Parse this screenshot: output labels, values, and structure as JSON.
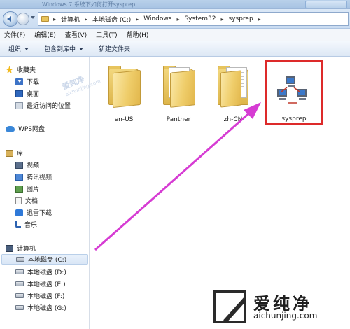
{
  "window": {
    "title_faded": "Windows 7 系统下如何打开sysprep"
  },
  "address": {
    "crumbs": [
      "计算机",
      "本地磁盘 (C:)",
      "Windows",
      "System32",
      "sysprep"
    ],
    "separator": "▸"
  },
  "menu": [
    "文件(F)",
    "编辑(E)",
    "查看(V)",
    "工具(T)",
    "帮助(H)"
  ],
  "toolbar": {
    "organize": "组织",
    "include_library": "包含到库中",
    "new_folder": "新建文件夹"
  },
  "sidebar": {
    "favorites": {
      "label": "收藏夹",
      "items": [
        "下载",
        "桌面",
        "最近访问的位置"
      ]
    },
    "wps": {
      "label": "WPS网盘"
    },
    "libraries": {
      "label": "库",
      "items": [
        "视频",
        "腾讯视频",
        "图片",
        "文档",
        "迅雷下载",
        "音乐"
      ]
    },
    "computer": {
      "label": "计算机",
      "drives": [
        "本地磁盘 (C:)",
        "本地磁盘 (D:)",
        "本地磁盘 (E:)",
        "本地磁盘 (F:)",
        "本地磁盘 (G:)"
      ],
      "selected": "本地磁盘 (C:)"
    }
  },
  "files": [
    "en-US",
    "Panther",
    "zh-CN",
    "sysprep"
  ],
  "annotation": {
    "highlight_color": "#dd2a2a",
    "arrow_color": "#d63cd3",
    "target": "sysprep"
  },
  "watermark": {
    "brand": "爱纯净",
    "url": "aichunjing.com",
    "mid_text": "爱纯净",
    "mid_sub": "aichunjing.com"
  }
}
